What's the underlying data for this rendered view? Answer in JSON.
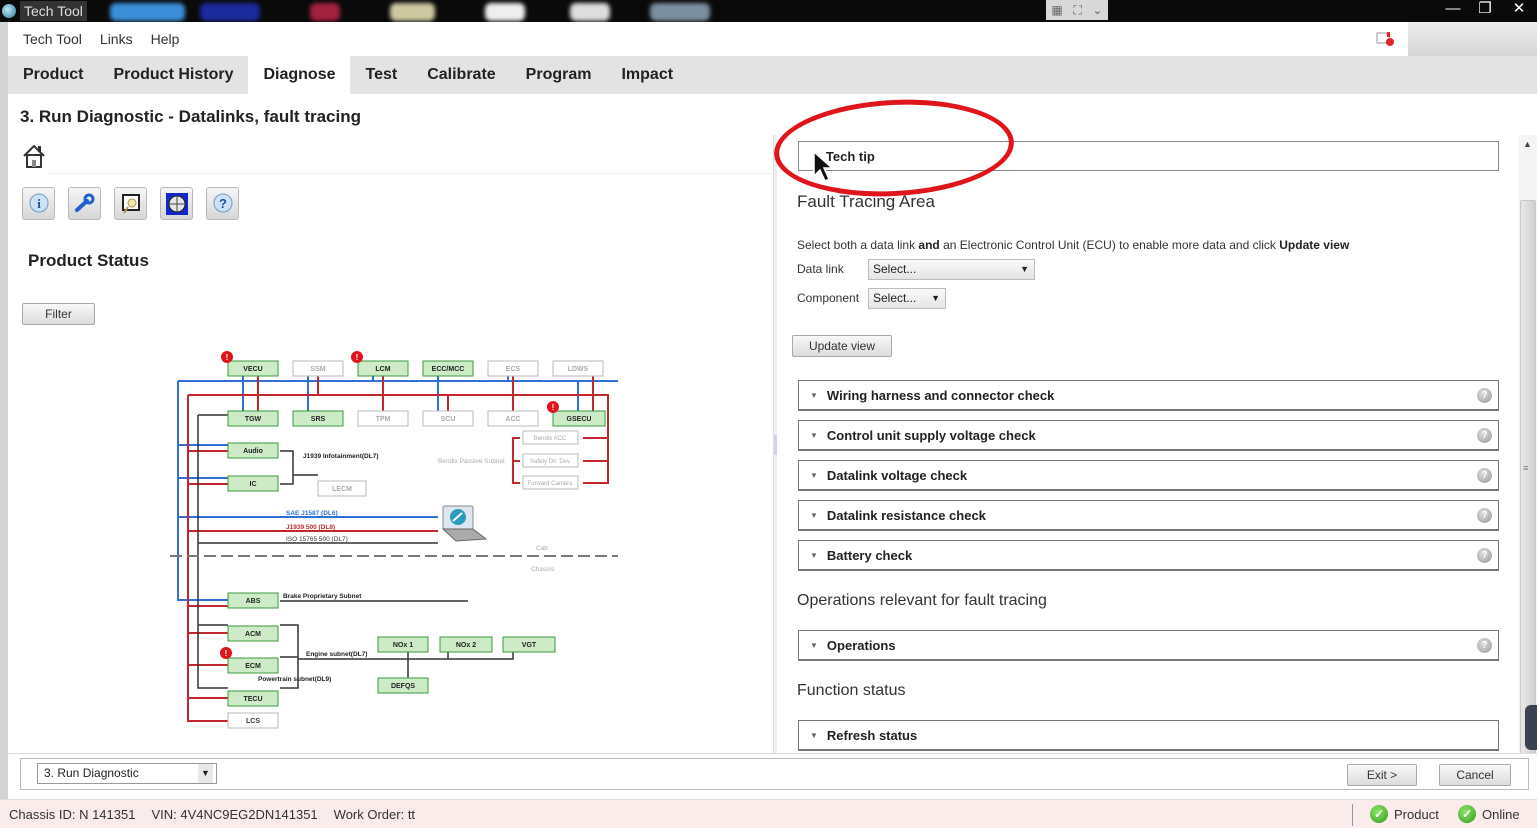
{
  "window": {
    "title": "Tech Tool",
    "controls": {
      "minimize": "—",
      "restore": "❐",
      "close": "✕"
    }
  },
  "menu": {
    "items": [
      "Tech Tool",
      "Links",
      "Help"
    ],
    "notification_icon": "notification-icon"
  },
  "tabs": [
    {
      "label": "Product",
      "active": false
    },
    {
      "label": "Product History",
      "active": false
    },
    {
      "label": "Diagnose",
      "active": true
    },
    {
      "label": "Test",
      "active": false
    },
    {
      "label": "Calibrate",
      "active": false
    },
    {
      "label": "Program",
      "active": false
    },
    {
      "label": "Impact",
      "active": false
    }
  ],
  "page_title": "3. Run Diagnostic - Datalinks, fault tracing",
  "left": {
    "toolbar_icons": [
      "info-icon",
      "wrench-icon",
      "search-document-icon",
      "globe-icon",
      "help-icon"
    ],
    "product_status_title": "Product Status",
    "filter_label": "Filter",
    "diagram": {
      "ecus_active": [
        "VECU",
        "LCM",
        "ECC/MCC",
        "TGW",
        "SRS",
        "GSECU",
        "Audio",
        "IC",
        "ABS",
        "ACM",
        "ECM",
        "TECU",
        "NOx 1",
        "NOx 2",
        "VGT",
        "DEFQS"
      ],
      "ecus_inactive": [
        "SSM",
        "ECS",
        "LDWS",
        "TPM",
        "SCU",
        "ACC",
        "LECM",
        "LCS",
        "Bendix ACC",
        "Safety Dir. Dev",
        "Forward Camera"
      ],
      "fault_ecus": [
        "VECU",
        "LCM",
        "GSECU",
        "ECM"
      ],
      "labels": {
        "infotainment": "J1939 Infotainment(DL7)",
        "bendix": "Bendix Passive Subnet",
        "sae": "SAE J1587 (DL6)",
        "j1939": "J1939 500 (DL8)",
        "iso": "ISO 15765 500 (DL7)",
        "cab": "Cab",
        "chassis": "Chassis",
        "brake": "Brake Proprietary Subnet",
        "engine": "Engine subnet(DL7)",
        "powertrain": "Powertrain subnet(DL9)"
      },
      "colors": {
        "blue": "#2f6fd6",
        "red": "#c0282d",
        "green_fill": "#cdebc6",
        "green_border": "#3c9a3c"
      }
    }
  },
  "right": {
    "tech_tip": "Tech tip",
    "fault_tracing_title": "Fault Tracing Area",
    "instruction_pre": "Select both a data link ",
    "instruction_and": "and",
    "instruction_mid": " an Electronic Control Unit (ECU) to enable more data and click ",
    "instruction_bold": "Update view",
    "data_link_label": "Data link",
    "data_link_value": "Select...",
    "component_label": "Component",
    "component_value": "Select...",
    "update_view": "Update view",
    "checks": [
      "Wiring harness and connector check",
      "Control unit supply voltage check",
      "Datalink voltage check",
      "Datalink resistance check",
      "Battery check"
    ],
    "operations_title": "Operations relevant for fault tracing",
    "operations_item": "Operations",
    "function_status_title": "Function status",
    "refresh_status": "Refresh status"
  },
  "bottom": {
    "step_select": "3. Run Diagnostic",
    "exit": "Exit >",
    "cancel": "Cancel"
  },
  "status": {
    "chassis": "Chassis ID: N 141351",
    "vin": "VIN: 4V4NC9EG2DN141351",
    "work_order": "Work Order: tt",
    "product": "Product",
    "online": "Online",
    "ok_color": "#2e9a1c"
  }
}
